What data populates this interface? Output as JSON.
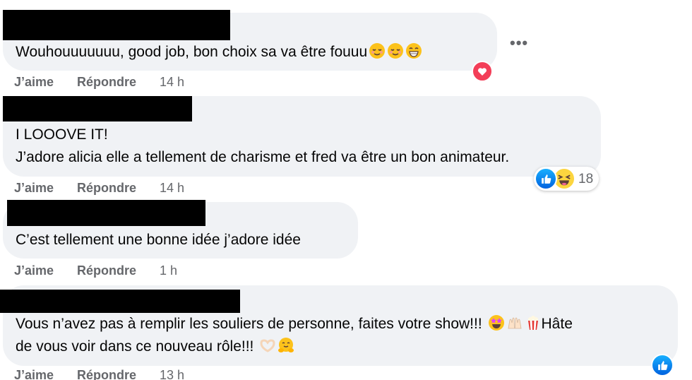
{
  "comments": [
    {
      "lines": [
        "Wouhouuuuuuu, good job, bon choix sa va être fouuu"
      ],
      "emojis": [
        "relieved-face",
        "relieved-face",
        "grinning-face"
      ],
      "like_label": "J’aime",
      "reply_label": "Répondre",
      "time": "14 h",
      "reaction_types": [
        "love"
      ],
      "reaction_count": ""
    },
    {
      "lines": [
        "I LOOOVE IT!",
        "J’adore alicia elle a tellement de charisme et fred va être un bon animateur."
      ],
      "like_label": "J’aime",
      "reply_label": "Répondre",
      "time": "14 h",
      "reaction_types": [
        "like",
        "haha"
      ],
      "reaction_count": "18"
    },
    {
      "lines": [
        "C’est tellement une bonne idée j’adore idée"
      ],
      "like_label": "J’aime",
      "reply_label": "Répondre",
      "time": "1 h"
    },
    {
      "line1_text": "Vous n’avez pas à remplir les souliers de personne, faites votre show!!!",
      "line1_after": "Hâte",
      "line2_text": "de vous voir dans ce nouveau rôle!!!",
      "emojis_line1": [
        "star-struck-face",
        "raising-hands",
        "popcorn"
      ],
      "emojis_line2": [
        "heart-hands",
        "hugging-face"
      ],
      "like_label": "J’aime",
      "reply_label": "Répondre",
      "time": "13 h",
      "reaction_types": [
        "like"
      ],
      "reaction_count": ""
    }
  ],
  "more_options": "•••",
  "colors": {
    "bubble": "#f0f2f5",
    "meta": "#65676b",
    "love": "#f33e58",
    "like": "#0866ff"
  }
}
